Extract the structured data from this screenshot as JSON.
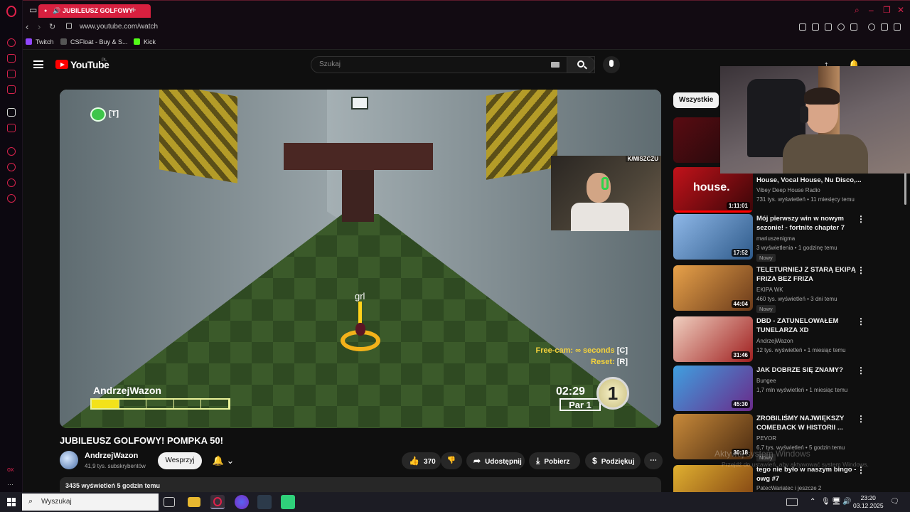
{
  "browser": {
    "tab_title": "JUBILEUSZ GOLFOWY",
    "url": "www.youtube.com/watch",
    "bookmarks": [
      "Twitch",
      "CSFloat - Buy & S...",
      "Kick"
    ],
    "rail_text": "ox"
  },
  "youtube": {
    "logo_text": "YouTube",
    "country_code": "PL",
    "search_placeholder": "Szukaj"
  },
  "video": {
    "chat_hint": "[T]",
    "cam_tag": "K/MISZCZU",
    "ball_label": "grl",
    "freecam_label": "Free-cam: ∞ seconds",
    "freecam_key": "[C]",
    "reset_label": "Reset:",
    "reset_key": "[R]",
    "player_name": "AndrzejWazon",
    "power_level": 0.2,
    "timer": "02:29",
    "par": "Par 1",
    "stroke": "1",
    "title": "JUBILEUSZ GOLFOWY! POMPKA 50!",
    "channel": "AndrzejWazon",
    "subscribers": "41,9 tys. subskrybentów",
    "support_label": "Wesprzyj",
    "likes": "370",
    "share_label": "Udostępnij",
    "download_label": "Pobierz",
    "thanks_label": "Podziękuj",
    "views_line": "3435 wyświetleń  5 godzin temu"
  },
  "sidebar": {
    "chip": "Wszystkie",
    "items": [
      {
        "title": "",
        "channel": "",
        "meta": "",
        "duration": "",
        "badge": ""
      },
      {
        "title": "House, Vocal House, Nu Disco,...",
        "channel": "Vibey Deep House Radio",
        "meta": "731 tys. wyświetleń • 11 miesięcy temu",
        "duration": "1:11:01",
        "badge": ""
      },
      {
        "title": "Mój pierwszy win w nowym sezonie! - fortnite chapter 7",
        "channel": "mariuszenigma",
        "meta": "3 wyświetlenia • 1 godzinę temu",
        "duration": "17:52",
        "badge": "Nowy"
      },
      {
        "title": "TELETURNIEJ Z STARĄ EKIPĄ FRIZA BEZ FRIZA",
        "channel": "EKIPA WK",
        "meta": "460 tys. wyświetleń • 3 dni temu",
        "duration": "44:04",
        "badge": "Nowy"
      },
      {
        "title": "DBD - ZATUNELOWAŁEM TUNELARZA XD",
        "channel": "AndrzejWazon",
        "meta": "12 tys. wyświetleń • 1 miesiąc temu",
        "duration": "31:46",
        "badge": ""
      },
      {
        "title": "JAK DOBRZE SIĘ ZNAMY?",
        "channel": "Bungee",
        "meta": "1,7 mln wyświetleń • 1 miesiąc temu",
        "duration": "45:30",
        "badge": ""
      },
      {
        "title": "ZROBILIŚMY NAJWIĘKSZY COMEBACK W HISTORII ...",
        "channel": "PEVOR",
        "meta": "6,7 tys. wyświetleń • 5 godzin temu",
        "duration": "30:18",
        "badge": "Nowy"
      },
      {
        "title": "tego nie było w naszym bingo - owg #7",
        "channel": "PatecWariatec",
        "meta": "i jeszcze 2",
        "duration": "",
        "badge": ""
      }
    ]
  },
  "watermark": {
    "line1": "Aktywuj system Windows",
    "line2": "Przejdź do ustawień, aby aktywować system Windows."
  },
  "taskbar": {
    "search_label": "Wyszukaj",
    "time": "23:20",
    "date": "03.12.2025"
  }
}
